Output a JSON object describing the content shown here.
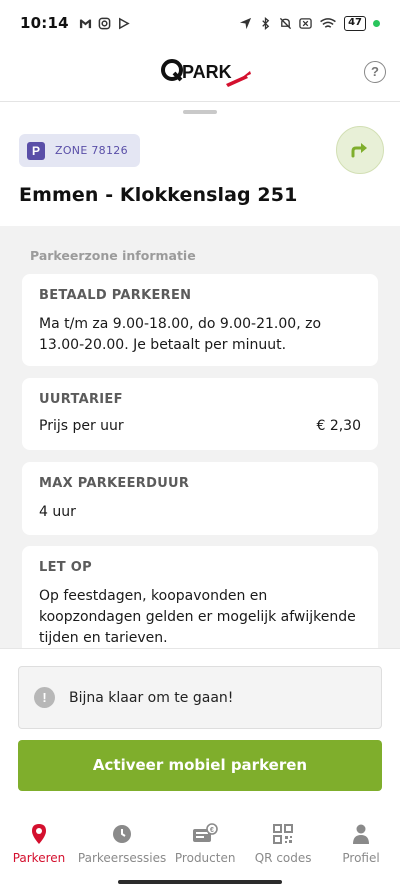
{
  "status": {
    "time": "10:14",
    "battery": "47",
    "left_icons": [
      "gmail-icon",
      "instagram-icon",
      "play-icon"
    ],
    "right_icons": [
      "location-icon",
      "bluetooth-icon",
      "mute-icon",
      "close-box-icon",
      "wifi-icon",
      "battery-icon"
    ]
  },
  "header": {
    "logo_text": "QPARK",
    "help_label": "?"
  },
  "zone": {
    "badge_letter": "P",
    "label": "ZONE 78126",
    "title": "Emmen - Klokkenslag 251"
  },
  "info": {
    "section_title": "Parkeerzone informatie",
    "cards": [
      {
        "heading": "BETAALD PARKEREN",
        "body": "Ma t/m za 9.00-18.00, do 9.00-21.00, zo 13.00-20.00. Je betaalt per minuut."
      },
      {
        "heading": "UURTARIEF",
        "row_label": "Prijs per uur",
        "row_value": "€ 2,30"
      },
      {
        "heading": "MAX PARKEERDUUR",
        "body": "4 uur"
      },
      {
        "heading": "LET OP",
        "body": "Op feestdagen, koopavonden en koopzondagen gelden er mogelijk afwijkende tijden en tarieven."
      }
    ]
  },
  "notice": {
    "icon": "!",
    "text": "Bijna klaar om te gaan!"
  },
  "cta": {
    "label": "Activeer mobiel parkeren"
  },
  "nav": {
    "items": [
      {
        "label": "Parkeren",
        "icon": "location-pin-icon",
        "active": true
      },
      {
        "label": "Parkeersessies",
        "icon": "clock-icon",
        "active": false
      },
      {
        "label": "Producten",
        "icon": "ticket-icon",
        "active": false
      },
      {
        "label": "QR codes",
        "icon": "qr-code-icon",
        "active": false
      },
      {
        "label": "Profiel",
        "icon": "person-icon",
        "active": false
      }
    ]
  },
  "colors": {
    "accent_green": "#7fae2c",
    "brand_red": "#d4102e",
    "zone_purple": "#5a4fa8"
  }
}
